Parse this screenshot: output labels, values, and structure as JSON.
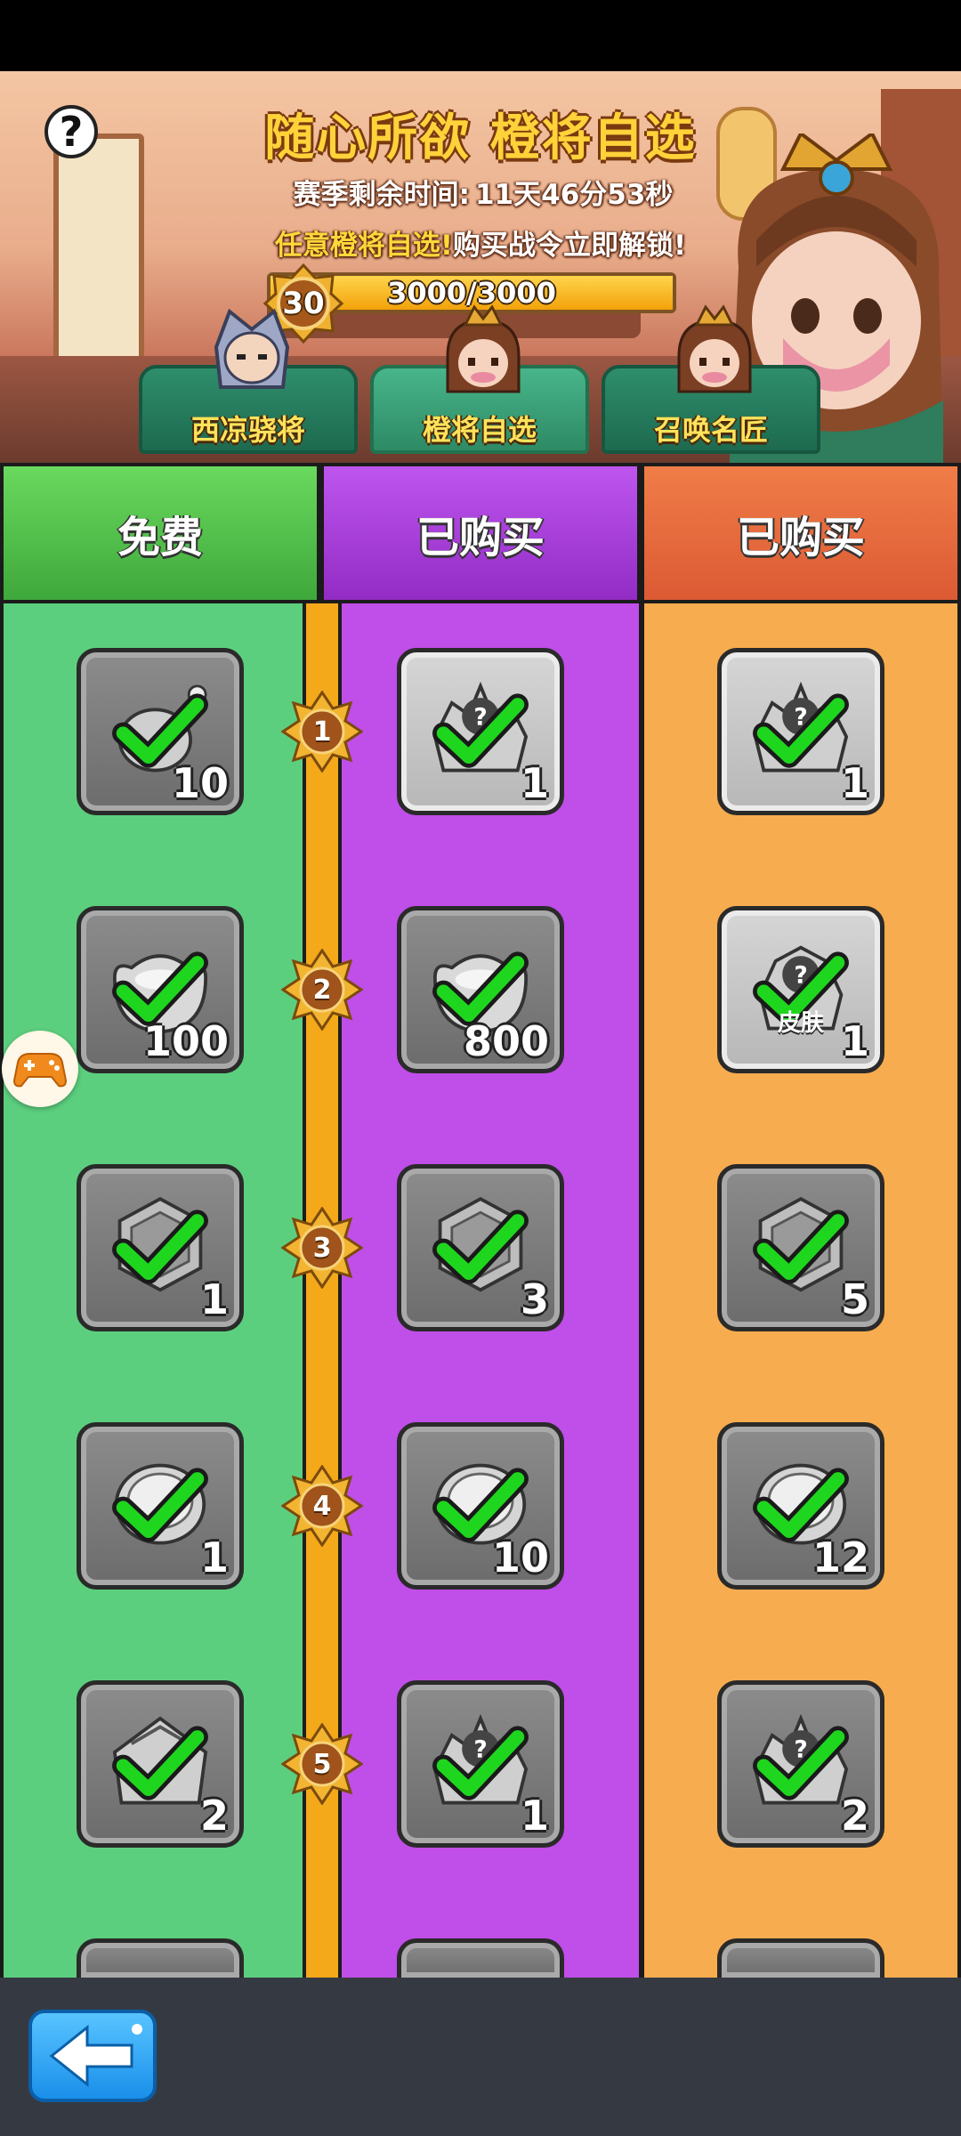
{
  "banner": {
    "title": "随心所欲 橙将自选",
    "countdown_label": "赛季剩余时间:",
    "countdown_value": "11天46分53秒",
    "promo_highlight": "任意橙将自选!",
    "promo_text": "购买战令立即解锁!",
    "level": "30",
    "progress_text": "3000/3000",
    "progress_fraction": 1.0,
    "help_label": "?"
  },
  "hero_tabs": [
    {
      "label": "西凉骁将",
      "active": false
    },
    {
      "label": "橙将自选",
      "active": true
    },
    {
      "label": "召唤名匠",
      "active": false
    }
  ],
  "columns": {
    "free_header": "免费",
    "premium_header": "已购买",
    "deluxe_header": "已购买"
  },
  "levels": [
    "1",
    "2",
    "3",
    "4",
    "5"
  ],
  "rewards": {
    "free": [
      {
        "icon": "meat-icon",
        "qty": "10",
        "claimed": true
      },
      {
        "icon": "silver-ingot-icon",
        "qty": "100",
        "claimed": true
      },
      {
        "icon": "hex-token-icon",
        "qty": "1",
        "claimed": true
      },
      {
        "icon": "coin-icon",
        "qty": "1",
        "claimed": true
      },
      {
        "icon": "mystery-chest-icon",
        "qty": "2",
        "claimed": true
      }
    ],
    "premium": [
      {
        "icon": "mystery-box-icon",
        "qty": "1",
        "claimed": true
      },
      {
        "icon": "silver-ingot-icon",
        "qty": "800",
        "claimed": true
      },
      {
        "icon": "hex-token-icon",
        "qty": "3",
        "claimed": true
      },
      {
        "icon": "coin-icon",
        "qty": "10",
        "claimed": true
      },
      {
        "icon": "mystery-box-icon",
        "qty": "1",
        "claimed": true
      }
    ],
    "deluxe": [
      {
        "icon": "mystery-box-icon",
        "qty": "1",
        "claimed": true
      },
      {
        "icon": "skin-box-icon",
        "qty": "1",
        "claimed": true,
        "sublabel": "皮肤"
      },
      {
        "icon": "hex-token-icon",
        "qty": "5",
        "claimed": true
      },
      {
        "icon": "coin-icon",
        "qty": "12",
        "claimed": true
      },
      {
        "icon": "mystery-box-icon",
        "qty": "2",
        "claimed": true
      }
    ]
  },
  "colors": {
    "free": "#5ccf7e",
    "free_header": "#55c555",
    "premium": "#c04ee8",
    "premium_header": "#a43bd2",
    "deluxe": "#f7ac4f",
    "deluxe_header": "#e5693f",
    "track": "#f4a91a",
    "check": "#1fd61f"
  }
}
